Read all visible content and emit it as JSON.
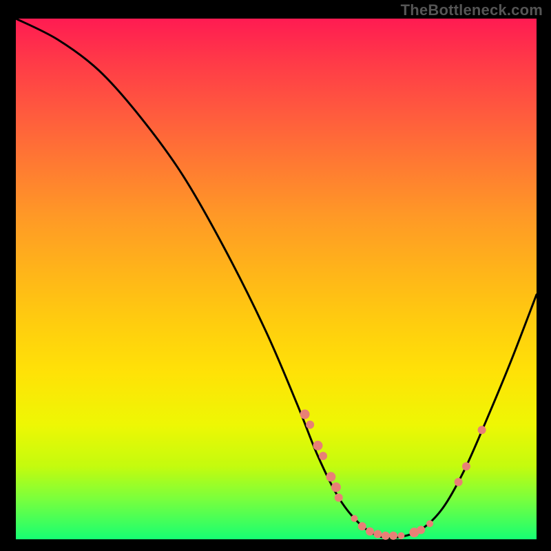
{
  "attribution": "TheBottleneck.com",
  "chart_data": {
    "type": "line",
    "title": "",
    "xlabel": "",
    "ylabel": "",
    "x_range": [
      0,
      100
    ],
    "y_range": [
      0,
      100
    ],
    "curve": [
      {
        "x": 0,
        "y": 100
      },
      {
        "x": 8,
        "y": 96
      },
      {
        "x": 16,
        "y": 90
      },
      {
        "x": 24,
        "y": 81
      },
      {
        "x": 32,
        "y": 70
      },
      {
        "x": 40,
        "y": 56
      },
      {
        "x": 48,
        "y": 40
      },
      {
        "x": 54,
        "y": 26
      },
      {
        "x": 58,
        "y": 16
      },
      {
        "x": 62,
        "y": 8
      },
      {
        "x": 66,
        "y": 3
      },
      {
        "x": 70,
        "y": 0.5
      },
      {
        "x": 74,
        "y": 0.5
      },
      {
        "x": 78,
        "y": 2
      },
      {
        "x": 82,
        "y": 6
      },
      {
        "x": 86,
        "y": 13
      },
      {
        "x": 90,
        "y": 22
      },
      {
        "x": 95,
        "y": 34
      },
      {
        "x": 100,
        "y": 47
      }
    ],
    "scatter_points": [
      {
        "x": 55.5,
        "y": 24,
        "r": 7
      },
      {
        "x": 56.5,
        "y": 22,
        "r": 6
      },
      {
        "x": 58.0,
        "y": 18,
        "r": 7
      },
      {
        "x": 59.0,
        "y": 16,
        "r": 6
      },
      {
        "x": 60.5,
        "y": 12,
        "r": 7
      },
      {
        "x": 61.5,
        "y": 10,
        "r": 7
      },
      {
        "x": 62.0,
        "y": 8,
        "r": 6
      },
      {
        "x": 65.0,
        "y": 4,
        "r": 5
      },
      {
        "x": 66.5,
        "y": 2.5,
        "r": 6
      },
      {
        "x": 68.0,
        "y": 1.5,
        "r": 6
      },
      {
        "x": 69.5,
        "y": 1,
        "r": 6
      },
      {
        "x": 71.0,
        "y": 0.7,
        "r": 6
      },
      {
        "x": 72.5,
        "y": 0.7,
        "r": 6
      },
      {
        "x": 74.0,
        "y": 0.7,
        "r": 5
      },
      {
        "x": 76.5,
        "y": 1.3,
        "r": 7
      },
      {
        "x": 77.8,
        "y": 1.8,
        "r": 6
      },
      {
        "x": 79.5,
        "y": 3,
        "r": 5
      },
      {
        "x": 85.0,
        "y": 11,
        "r": 6
      },
      {
        "x": 86.5,
        "y": 14,
        "r": 6
      },
      {
        "x": 89.5,
        "y": 21,
        "r": 6
      }
    ],
    "colors": {
      "curve": "#000000",
      "points": "#e88076",
      "gradient_top": "#ff1b52",
      "gradient_bottom": "#16ff73"
    }
  }
}
